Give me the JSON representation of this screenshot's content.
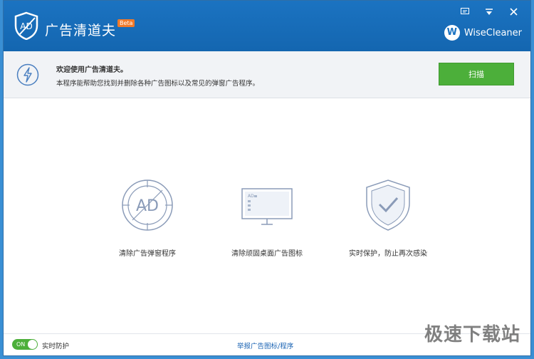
{
  "window": {
    "title": "广告清道夫",
    "beta_badge": "Beta",
    "brand": "WiseCleaner",
    "brand_logo_letter": "W",
    "controls": [
      "feedback-icon",
      "menu-icon",
      "close-icon"
    ]
  },
  "infobar": {
    "title": "欢迎使用广告清道夫。",
    "description": "本程序能帮助您找到并删除各种广告图标以及常见的弹窗广告程序。",
    "scan_button": "扫描"
  },
  "features": [
    {
      "label": "清除广告弹窗程序",
      "icon": "ad-target-icon",
      "icon_text": "AD"
    },
    {
      "label": "清除顽固桌面广告图标",
      "icon": "monitor-icon",
      "icon_text": "AD"
    },
    {
      "label": "实时保护，防止再次感染",
      "icon": "shield-check-icon"
    }
  ],
  "footer": {
    "toggle_state": "ON",
    "toggle_label": "实时防护",
    "report_link": "举报广告图标/程序",
    "watermark": "极速下载站"
  },
  "colors": {
    "titlebar": "#1b73c1",
    "accent_green": "#4caf3a",
    "icon_stroke": "#8a9bb8"
  }
}
